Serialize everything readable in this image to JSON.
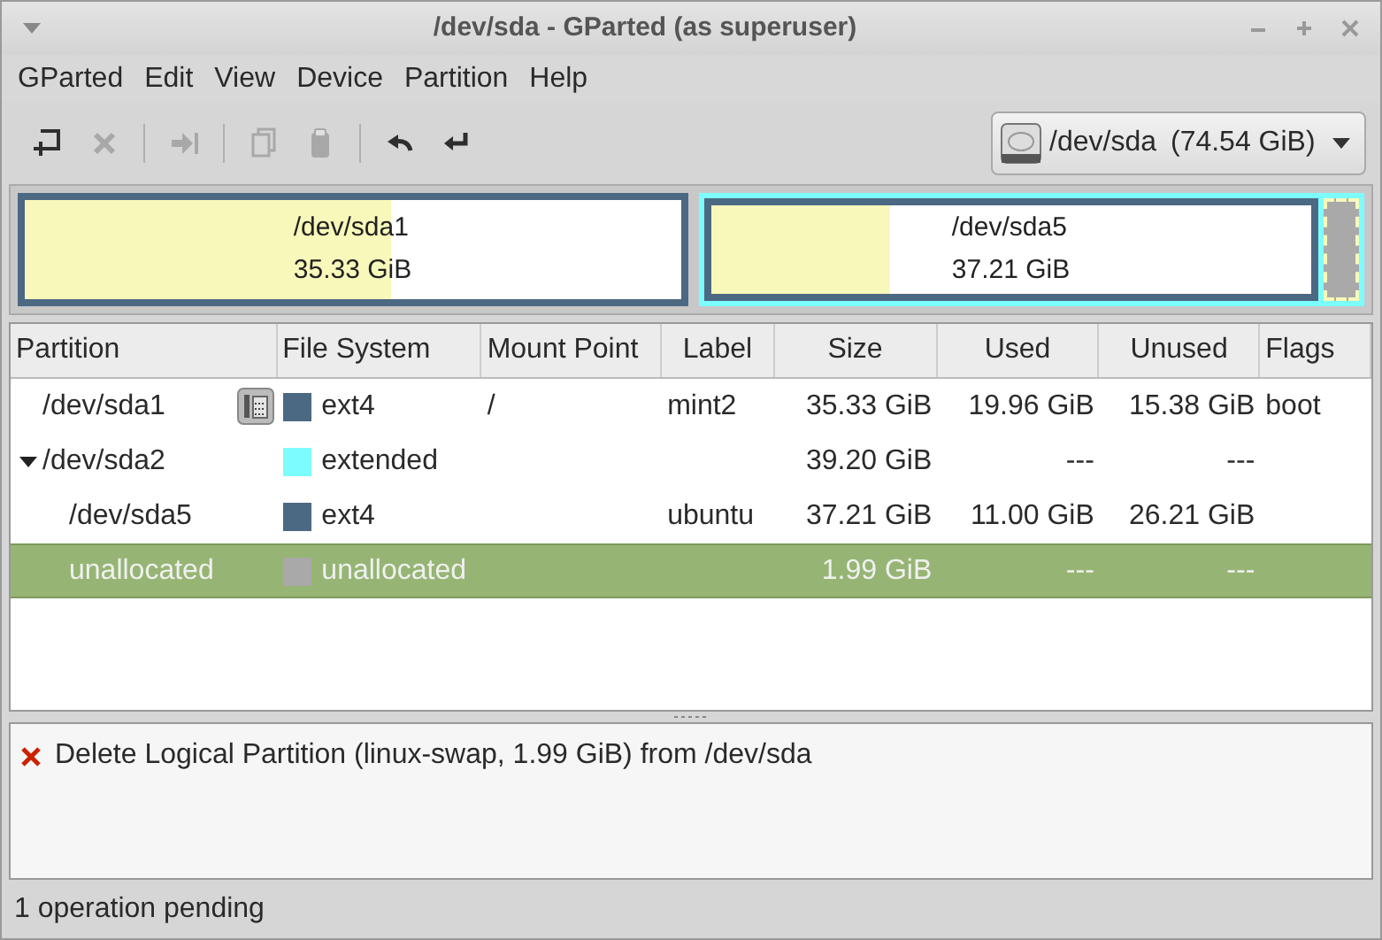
{
  "window": {
    "title": "/dev/sda - GParted (as superuser)"
  },
  "menu": [
    "GParted",
    "Edit",
    "View",
    "Device",
    "Partition",
    "Help"
  ],
  "toolbar": [
    {
      "kind": "new",
      "disabled": false
    },
    {
      "kind": "delete",
      "disabled": true
    },
    {
      "kind": "separator"
    },
    {
      "kind": "resize",
      "disabled": true
    },
    {
      "kind": "separator"
    },
    {
      "kind": "copy",
      "disabled": true
    },
    {
      "kind": "paste",
      "disabled": true
    },
    {
      "kind": "separator"
    },
    {
      "kind": "undo",
      "disabled": false
    },
    {
      "kind": "apply",
      "disabled": false
    }
  ],
  "device_selector": {
    "device": "/dev/sda",
    "size": "(74.54 GiB)"
  },
  "disk_map": [
    {
      "kind": "partition",
      "name": "/dev/sda1",
      "size": "35.33 GiB",
      "color": "#4b6983",
      "level": 0.56,
      "selected": false
    },
    {
      "kind": "extended",
      "color": "#7dfcfe",
      "selected": false,
      "children": [
        {
          "kind": "partition",
          "name": "/dev/sda5",
          "size": "37.21 GiB",
          "color": "#4b6983",
          "level": 0.3,
          "selected": false
        },
        {
          "kind": "unallocated",
          "color": "#a9a9a9",
          "selected": true
        }
      ]
    }
  ],
  "table": {
    "columns": [
      "Partition",
      "File System",
      "Mount Point",
      "Label",
      "Size",
      "Used",
      "Unused",
      "Flags"
    ],
    "rows": [
      {
        "partition": "/dev/sda1",
        "mounted": true,
        "fs": "ext4",
        "color": "#4b6983",
        "mount": "/",
        "label": "mint2",
        "size": "35.33 GiB",
        "used": "19.96 GiB",
        "unused": "15.38 GiB",
        "flags": "boot",
        "selected": false
      },
      {
        "partition": "/dev/sda2",
        "mounted": false,
        "fs": "extended",
        "color": "#7dfcfe",
        "size": "39.20 GiB",
        "used": "---",
        "unused": "---",
        "selected": false,
        "expanded": true,
        "children": [
          {
            "partition": "/dev/sda5",
            "mounted": false,
            "fs": "ext4",
            "color": "#4b6983",
            "label": "ubuntu",
            "size": "37.21 GiB",
            "used": "11.00 GiB",
            "unused": "26.21 GiB",
            "selected": false
          },
          {
            "partition": "unallocated",
            "mounted": false,
            "fs": "unallocated",
            "color": "#a9a9a9",
            "size": "1.99 GiB",
            "used": "---",
            "unused": "---",
            "selected": true
          }
        ]
      }
    ]
  },
  "operations": [
    {
      "text": "Delete Logical Partition (linux-swap, 1.99 GiB) from /dev/sda"
    }
  ],
  "status_bar": "1 operation pending"
}
